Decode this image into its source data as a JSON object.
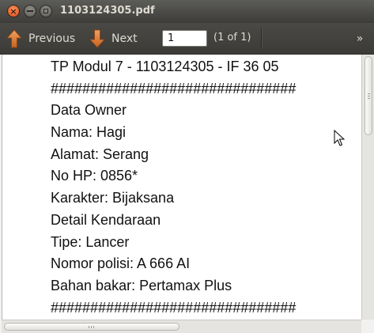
{
  "window": {
    "title": "1103124305.pdf"
  },
  "toolbar": {
    "previous_label": "Previous",
    "next_label": "Next",
    "page_value": "1",
    "page_count": "(1 of 1)"
  },
  "icons": {
    "previous": "arrow-up-icon",
    "next": "arrow-down-icon",
    "menu": "chevron-right-icon"
  },
  "colors": {
    "arrow_accent": "#e07a30"
  },
  "document": {
    "lines": [
      "TP Modul 7 - 1103124305 - IF 36 05",
      "###############################",
      "Data Owner",
      "Nama: Hagi",
      "Alamat: Serang",
      "No HP: 0856*",
      "Karakter: Bijaksana",
      "Detail Kendaraan",
      "Tipe: Lancer",
      "Nomor polisi: A 666 AI",
      "Bahan bakar: Pertamax Plus",
      "###############################"
    ]
  }
}
